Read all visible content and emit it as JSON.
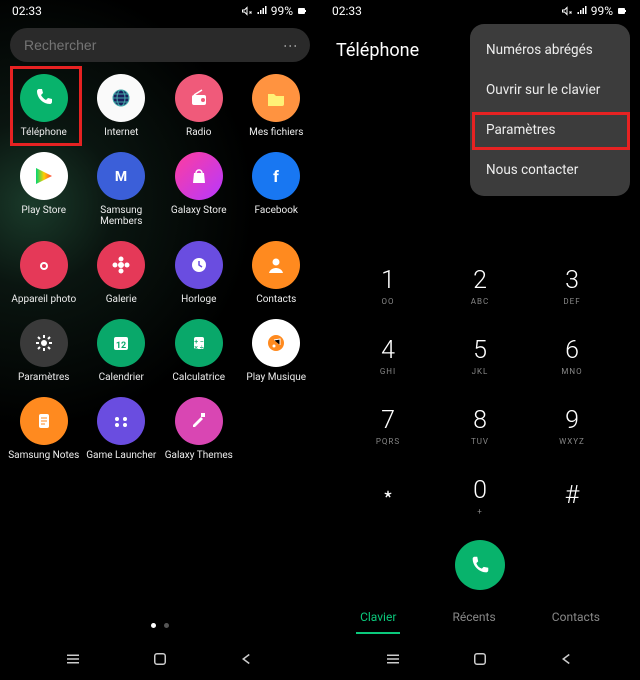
{
  "status": {
    "time": "02:33",
    "battery": "99%"
  },
  "left": {
    "search_placeholder": "Rechercher",
    "apps": [
      {
        "name": "Téléphone",
        "bg": "#08b36c",
        "glyph": "phone"
      },
      {
        "name": "Internet",
        "bg": "#fafafa",
        "glyph": "globe"
      },
      {
        "name": "Radio",
        "bg": "#f05a7a",
        "glyph": "radio"
      },
      {
        "name": "Mes fichiers",
        "bg": "#ff9340",
        "glyph": "folder"
      },
      {
        "name": "Play Store",
        "bg": "#ffffff",
        "glyph": "play"
      },
      {
        "name": "Samsung Members",
        "bg": "#3b5fd9",
        "glyph": "m"
      },
      {
        "name": "Galaxy Store",
        "bg": "linear-gradient(135deg,#ff3d9e,#b638ff)",
        "glyph": "bag"
      },
      {
        "name": "Facebook",
        "bg": "#1877f2",
        "glyph": "f"
      },
      {
        "name": "Appareil photo",
        "bg": "#e53958",
        "glyph": "camera"
      },
      {
        "name": "Galerie",
        "bg": "#e53958",
        "glyph": "flower"
      },
      {
        "name": "Horloge",
        "bg": "#6a4de0",
        "glyph": "clock"
      },
      {
        "name": "Contacts",
        "bg": "#ff8a1f",
        "glyph": "person"
      },
      {
        "name": "Paramètres",
        "bg": "#3a3a3a",
        "glyph": "gear"
      },
      {
        "name": "Calendrier",
        "bg": "#09a86a",
        "glyph": "cal"
      },
      {
        "name": "Calculatrice",
        "bg": "#09a86a",
        "glyph": "calc"
      },
      {
        "name": "Play Musique",
        "bg": "#fff",
        "glyph": "music"
      },
      {
        "name": "Samsung Notes",
        "bg": "#ff8a1f",
        "glyph": "note"
      },
      {
        "name": "Game Launcher",
        "bg": "#6a4de0",
        "glyph": "game"
      },
      {
        "name": "Galaxy Themes",
        "bg": "#d946b3",
        "glyph": "brush"
      }
    ]
  },
  "right": {
    "title": "Téléphone",
    "menu": [
      "Numéros abrégés",
      "Ouvrir sur le clavier",
      "Paramètres",
      "Nous contacter"
    ],
    "keys": [
      {
        "n": "1",
        "s": "OO"
      },
      {
        "n": "2",
        "s": "ABC"
      },
      {
        "n": "3",
        "s": "DEF"
      },
      {
        "n": "4",
        "s": "GHI"
      },
      {
        "n": "5",
        "s": "JKL"
      },
      {
        "n": "6",
        "s": "MNO"
      },
      {
        "n": "7",
        "s": "PQRS"
      },
      {
        "n": "8",
        "s": "TUV"
      },
      {
        "n": "9",
        "s": "WXYZ"
      },
      {
        "n": "﹡",
        "s": ""
      },
      {
        "n": "0",
        "s": "+"
      },
      {
        "n": "#",
        "s": ""
      }
    ],
    "tabs": [
      {
        "label": "Clavier",
        "active": true
      },
      {
        "label": "Récents",
        "active": false
      },
      {
        "label": "Contacts",
        "active": false
      }
    ]
  }
}
